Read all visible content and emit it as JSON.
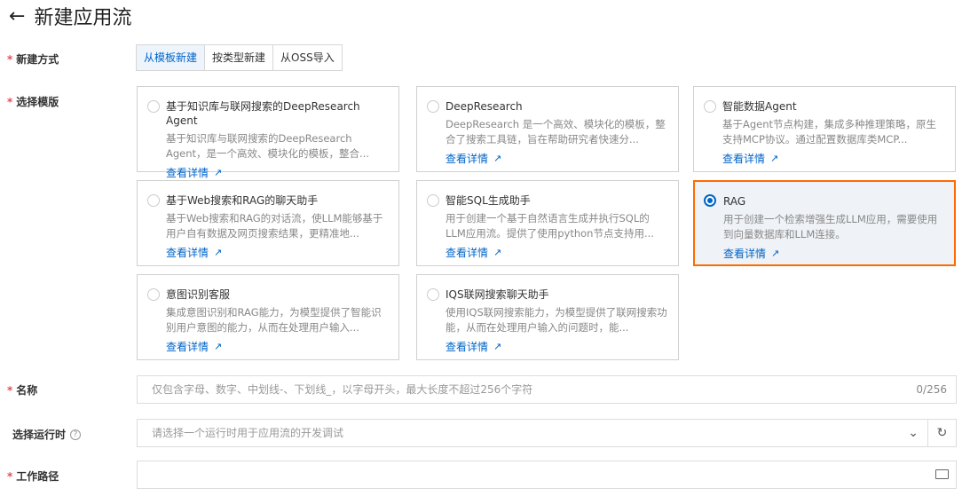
{
  "header": {
    "title": "新建应用流"
  },
  "form": {
    "method_label": "新建方式",
    "method_tabs": [
      "从模板新建",
      "按类型新建",
      "从OSS导入"
    ],
    "template_label": "选择模版",
    "templates": [
      {
        "title": "基于知识库与联网搜索的DeepResearch Agent",
        "desc": "基于知识库与联网搜索的DeepResearch Agent，是一个高效、模块化的模板，整合...",
        "link": "查看详情"
      },
      {
        "title": "DeepResearch",
        "desc": "DeepResearch 是一个高效、模块化的模板，整合了搜索工具链，旨在帮助研究者快速分...",
        "link": "查看详情"
      },
      {
        "title": "智能数据Agent",
        "desc": "基于Agent节点构建，集成多种推理策略，原生支持MCP协议。通过配置数据库类MCP...",
        "link": "查看详情"
      },
      {
        "title": "基于Web搜索和RAG的聊天助手",
        "desc": "基于Web搜索和RAG的对话流，使LLM能够基于用户自有数据及网页搜索结果，更精准地...",
        "link": "查看详情"
      },
      {
        "title": "智能SQL生成助手",
        "desc": "用于创建一个基于自然语言生成并执行SQL的LLM应用流。提供了使用python节点支持用...",
        "link": "查看详情"
      },
      {
        "title": "RAG",
        "desc": "用于创建一个检索增强生成LLM应用，需要使用到向量数据库和LLM连接。",
        "link": "查看详情",
        "selected": true
      },
      {
        "title": "意图识别客服",
        "desc": "集成意图识别和RAG能力，为模型提供了智能识别用户意图的能力，从而在处理用户输入...",
        "link": "查看详情"
      },
      {
        "title": "IQS联网搜索聊天助手",
        "desc": "使用IQS联网搜索能力，为模型提供了联网搜索功能，从而在处理用户输入的问题时，能...",
        "link": "查看详情"
      }
    ],
    "name_label": "名称",
    "name_placeholder": "仅包含字母、数字、中划线-、下划线_，以字母开头，最大长度不超过256个字符",
    "name_count": "0/256",
    "runtime_label": "选择运行时",
    "runtime_placeholder": "请选择一个运行时用于应用流的开发调试",
    "path_label": "工作路径"
  }
}
